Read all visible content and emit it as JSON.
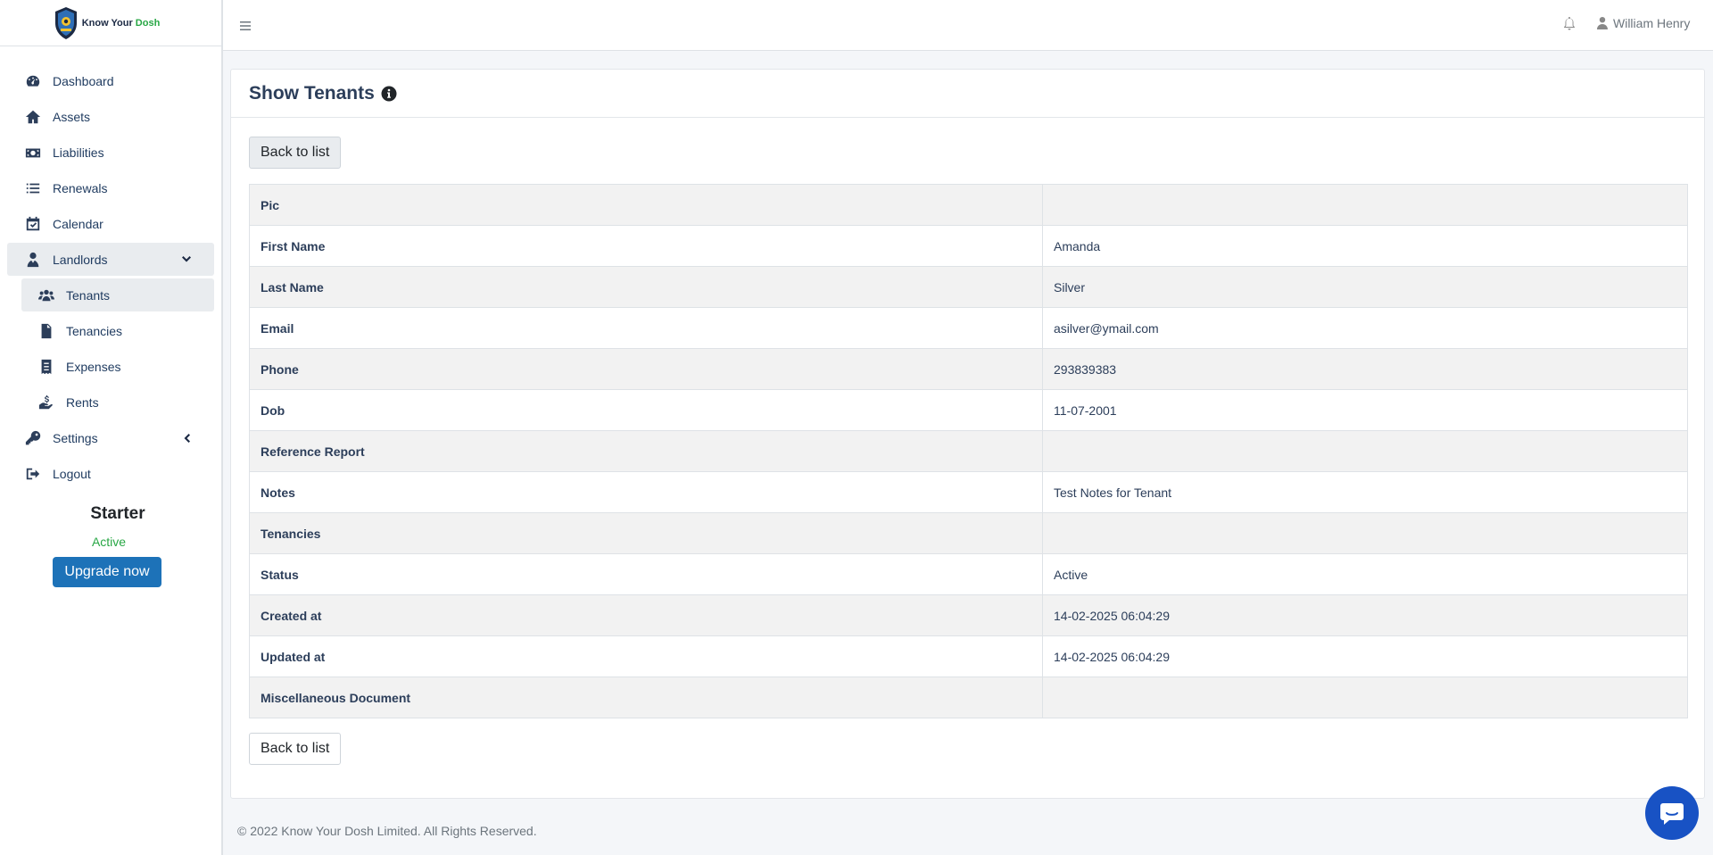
{
  "brand": {
    "name_part1": "Know Your ",
    "name_part2": "Dosh"
  },
  "sidebar": {
    "items": [
      {
        "label": "Dashboard",
        "icon": "dashboard-icon"
      },
      {
        "label": "Assets",
        "icon": "home-icon"
      },
      {
        "label": "Liabilities",
        "icon": "money-bill-icon"
      },
      {
        "label": "Renewals",
        "icon": "list-icon"
      },
      {
        "label": "Calendar",
        "icon": "calendar-check-icon"
      },
      {
        "label": "Landlords",
        "icon": "user-tie-icon",
        "expanded": true
      },
      {
        "label": "Tenants",
        "icon": "users-icon",
        "active": true
      },
      {
        "label": "Tenancies",
        "icon": "file-contract-icon"
      },
      {
        "label": "Expenses",
        "icon": "receipt-icon"
      },
      {
        "label": "Rents",
        "icon": "hand-holding-dollar-icon"
      },
      {
        "label": "Settings",
        "icon": "key-icon"
      },
      {
        "label": "Logout",
        "icon": "sign-out-icon"
      }
    ]
  },
  "plan": {
    "name": "Starter",
    "status": "Active",
    "upgrade_label": "Upgrade now"
  },
  "topbar": {
    "user_name": "William Henry"
  },
  "page": {
    "title": "Show Tenants",
    "back_label": "Back to list",
    "rows": [
      {
        "label": "Pic",
        "value": ""
      },
      {
        "label": "First Name",
        "value": "Amanda"
      },
      {
        "label": "Last Name",
        "value": "Silver"
      },
      {
        "label": "Email",
        "value": "asilver@ymail.com"
      },
      {
        "label": "Phone",
        "value": "293839383"
      },
      {
        "label": "Dob",
        "value": "11-07-2001"
      },
      {
        "label": "Reference Report",
        "value": ""
      },
      {
        "label": "Notes",
        "value": "Test Notes for Tenant"
      },
      {
        "label": "Tenancies",
        "value": ""
      },
      {
        "label": "Status",
        "value": "Active"
      },
      {
        "label": "Created at",
        "value": "14-02-2025 06:04:29"
      },
      {
        "label": "Updated at",
        "value": "14-02-2025 06:04:29"
      },
      {
        "label": "Miscellaneous Document",
        "value": ""
      }
    ]
  },
  "footer": {
    "text": "© 2022 Know Your Dosh Limited. All Rights Reserved."
  },
  "colors": {
    "accent": "#1d72b8",
    "active_green": "#28a745",
    "chat": "#1852c4",
    "text_dark": "#2c3e5a"
  }
}
